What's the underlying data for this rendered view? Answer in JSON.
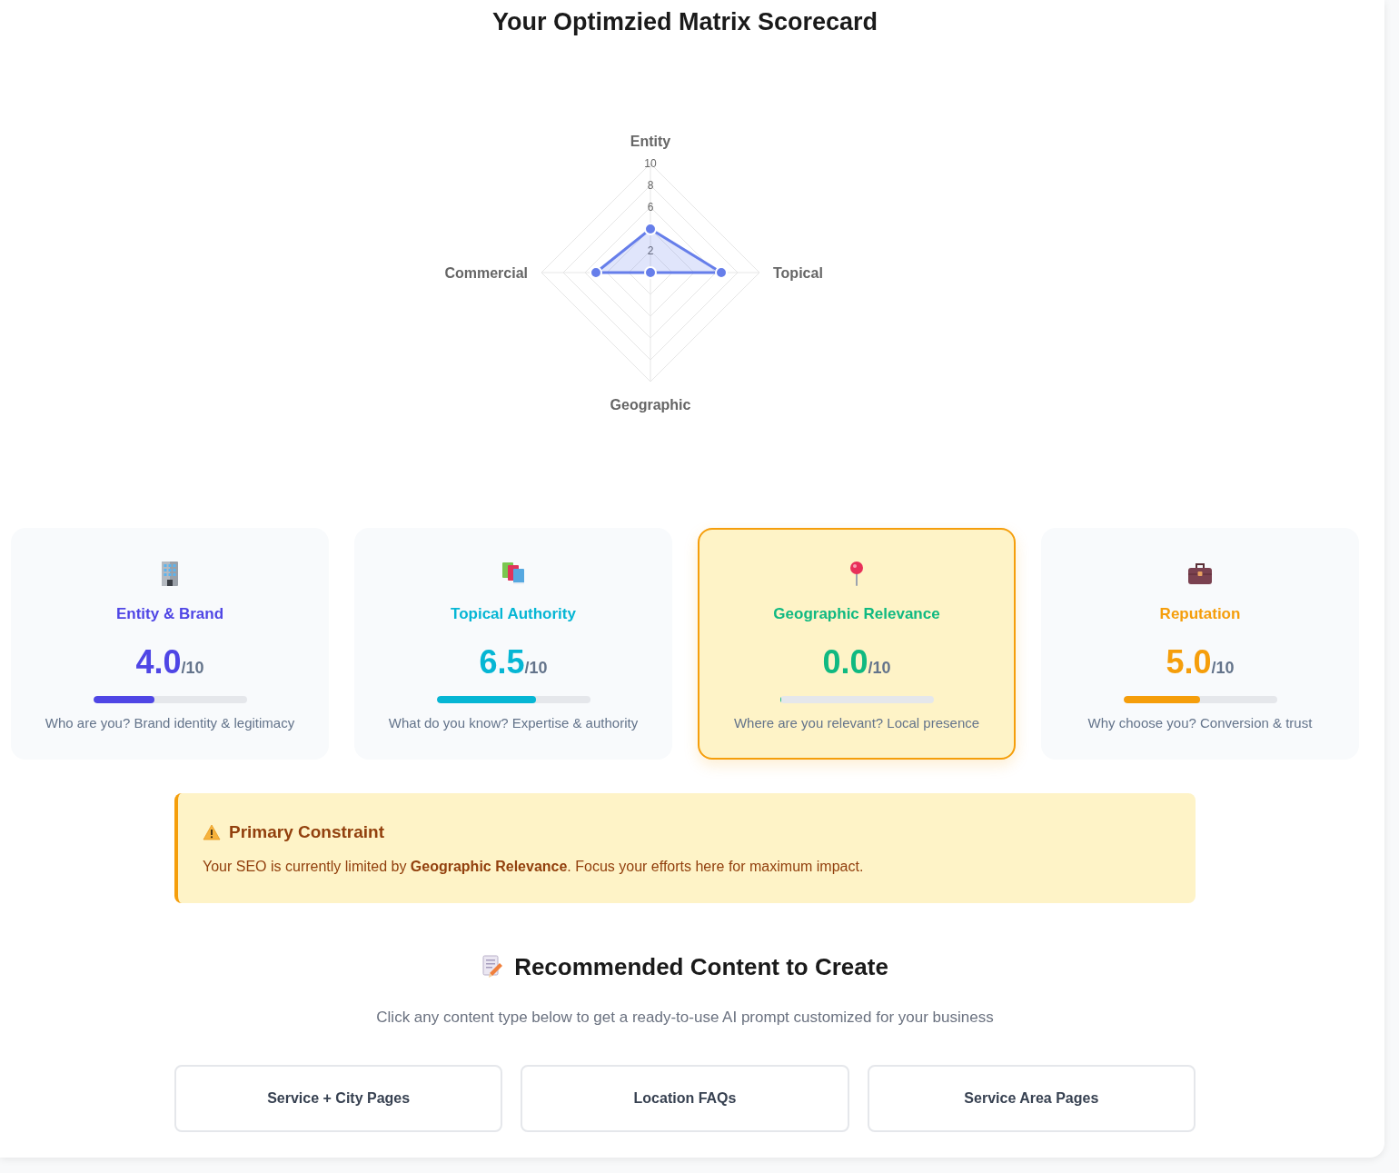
{
  "title": "Your Optimzied Matrix Scorecard",
  "radar": {
    "chart_data": {
      "type": "radar",
      "categories": [
        "Entity",
        "Topical",
        "Geographic",
        "Commercial"
      ],
      "series": [
        {
          "color": "#667eea",
          "values": [
            4,
            6.5,
            0,
            5
          ]
        }
      ],
      "ylim": [
        0,
        10
      ],
      "yticks": [
        2,
        6,
        8,
        10
      ]
    }
  },
  "cards": [
    {
      "title": "Entity & Brand",
      "score": "4.0",
      "scale": "/10",
      "level": 0.4,
      "description": "Who are you? Brand identity & legitimacy",
      "color": "#4f46e5",
      "highlighted": false
    },
    {
      "title": "Topical Authority",
      "score": "6.5",
      "scale": "/10",
      "level": 0.65,
      "description": "What do you know? Expertise & authority",
      "color": "#06b6d4",
      "highlighted": false
    },
    {
      "title": "Geographic Relevance",
      "score": "0.0",
      "scale": "/10",
      "level": 0,
      "description": "Where are you relevant? Local presence",
      "color": "#10b981",
      "highlighted": true
    },
    {
      "title": "Reputation",
      "score": "5.0",
      "scale": "/10",
      "level": 0.5,
      "description": "Why choose you? Conversion & trust",
      "color": "#f59e0b",
      "highlighted": false
    }
  ],
  "constraint": {
    "title": "Primary Constraint",
    "message": "Your SEO is currently limited by **Geographic Relevance**. Focus your efforts here for maximum impact."
  },
  "recommendations": {
    "heading": "Recommended Content to Create",
    "subtitle": "Click any content type below to get a ready-to-use AI prompt customized for your business",
    "buttons": [
      "Service + City Pages",
      "Location FAQs",
      "Service Area Pages"
    ]
  }
}
